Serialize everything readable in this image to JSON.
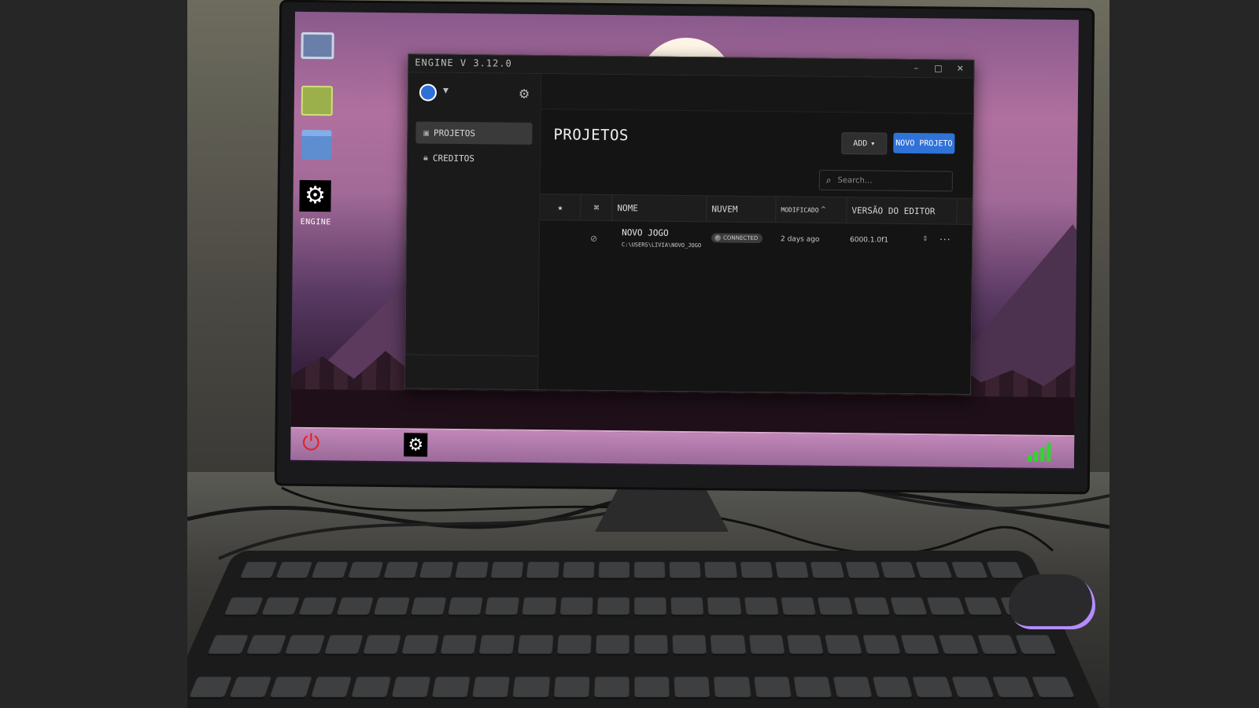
{
  "desktop": {
    "engine_icon_label": "ENGINE"
  },
  "app": {
    "title": "ENGINE V 3.12.0",
    "window_controls": {
      "minimize": "–",
      "maximize": "□",
      "close": "✕"
    }
  },
  "sidebar": {
    "items": [
      {
        "label": "PROJETOS",
        "icon": "cube-icon",
        "active": true
      },
      {
        "label": "CREDITOS",
        "icon": "lock-icon",
        "active": false
      }
    ]
  },
  "main": {
    "title": "PROJETOS",
    "add_label": "ADD",
    "new_project_label": "NOVO PROJETO",
    "search_placeholder": "Search...",
    "columns": {
      "name": "NOME",
      "cloud": "NUVEM",
      "modified": "MODIFICADO",
      "editor_version": "VERSÃO DO EDITOR"
    },
    "projects": [
      {
        "name": "NOVO JOGO",
        "path": "C:\\USERS\\LIVIA\\NOVO_JOGO",
        "cloud_status": "CONNECTED",
        "modified": "2 days ago",
        "editor_version": "6000.1.0f1"
      }
    ]
  },
  "colors": {
    "accent": "#2f72d8",
    "signal": "#2bd92b",
    "power": "#e22222"
  }
}
